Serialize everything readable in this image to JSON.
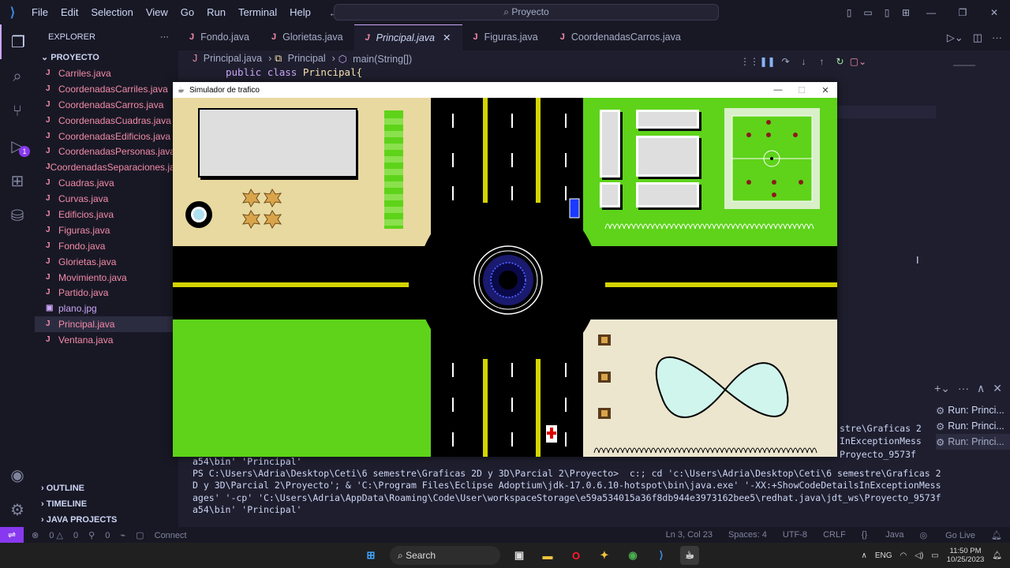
{
  "titlebar": {
    "menu": [
      "File",
      "Edit",
      "Selection",
      "View",
      "Go",
      "Run",
      "Terminal",
      "Help"
    ],
    "search": "Proyecto"
  },
  "sidebar": {
    "title": "EXPLORER",
    "project": "PROYECTO",
    "files": [
      "Carriles.java",
      "CoordenadasCarriles.java",
      "CoordenadasCarros.java",
      "CoordenadasCuadras.java",
      "CoordenadasEdificios.java",
      "CoordenadasPersonas.java",
      "CoordenadasSeparaciones.java",
      "Cuadras.java",
      "Curvas.java",
      "Edificios.java",
      "Figuras.java",
      "Fondo.java",
      "Glorietas.java",
      "Movimiento.java",
      "Partido.java",
      "plano.jpg",
      "Principal.java",
      "Ventana.java"
    ],
    "sections": [
      "OUTLINE",
      "TIMELINE",
      "JAVA PROJECTS"
    ]
  },
  "tabs": [
    "Fondo.java",
    "Glorietas.java",
    "Principal.java",
    "Figuras.java",
    "CoordenadasCarros.java"
  ],
  "editor": {
    "breadcrumb": [
      "Principal.java",
      "Principal",
      "main(String[])"
    ],
    "code_line": {
      "kw1": "public",
      "kw2": "class",
      "name": "Principal",
      "brace": "{"
    }
  },
  "simulator": {
    "title": "Simulador de trafico"
  },
  "panel": {
    "runs": [
      "Run: Princi...",
      "Run: Princi...",
      "Run: Princi..."
    ],
    "terminal_top": [
      "stre\\Graficas 2",
      "InExceptionMess",
      "Proyecto_9573f"
    ],
    "terminal": [
      "a54\\bin' 'Principal'",
      "PS C:\\Users\\Adria\\Desktop\\Ceti\\6 semestre\\Graficas 2D y 3D\\Parcial 2\\Proyecto>  c:; cd 'c:\\Users\\Adria\\Desktop\\Ceti\\6 semestre\\Graficas 2",
      "D y 3D\\Parcial 2\\Proyecto'; & 'C:\\Program Files\\Eclipse Adoptium\\jdk-17.0.6.10-hotspot\\bin\\java.exe' '-XX:+ShowCodeDetailsInExceptionMess",
      "ages' '-cp' 'C:\\Users\\Adria\\AppData\\Roaming\\Code\\User\\workspaceStorage\\e59a534015a36f8db944e3973162bee5\\redhat.java\\jdt_ws\\Proyecto_9573f",
      "a54\\bin' 'Principal'"
    ]
  },
  "statusbar": {
    "errors": "0",
    "warnings": "0",
    "ports": "0",
    "connect": "Connect",
    "position": "Ln 3, Col 23",
    "spaces": "Spaces: 4",
    "encoding": "UTF-8",
    "eol": "CRLF",
    "language": "Java",
    "golive": "Go Live"
  },
  "taskbar": {
    "search": "Search",
    "lang": "ENG",
    "time": "11:50 PM",
    "date": "10/25/2023"
  },
  "colors": {
    "grass": "#5ed31a",
    "sand": "#e8d9a0",
    "cream": "#ece6cf",
    "road": "#000000",
    "yellow_line": "#d4d400"
  }
}
